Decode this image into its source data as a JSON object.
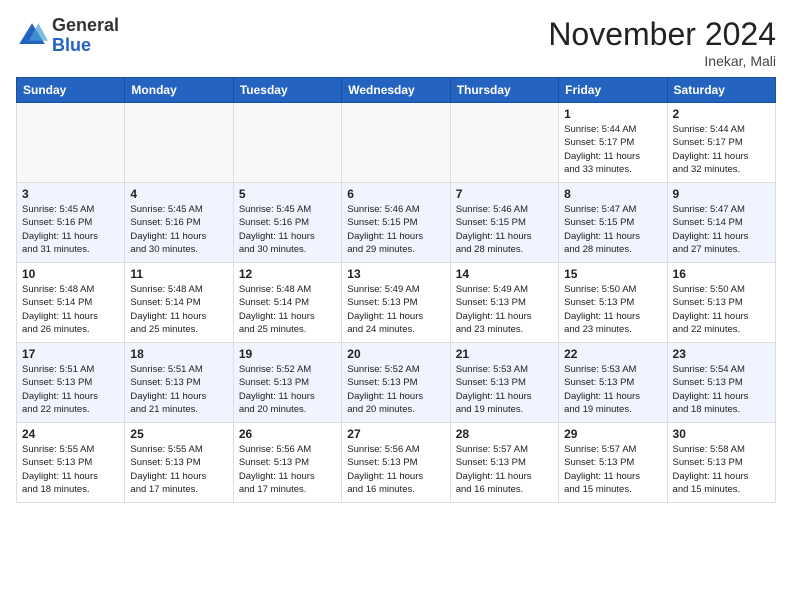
{
  "logo": {
    "general": "General",
    "blue": "Blue"
  },
  "title": "November 2024",
  "location": "Inekar, Mali",
  "weekdays": [
    "Sunday",
    "Monday",
    "Tuesday",
    "Wednesday",
    "Thursday",
    "Friday",
    "Saturday"
  ],
  "weeks": [
    [
      {
        "day": "",
        "info": ""
      },
      {
        "day": "",
        "info": ""
      },
      {
        "day": "",
        "info": ""
      },
      {
        "day": "",
        "info": ""
      },
      {
        "day": "",
        "info": ""
      },
      {
        "day": "1",
        "info": "Sunrise: 5:44 AM\nSunset: 5:17 PM\nDaylight: 11 hours\nand 33 minutes."
      },
      {
        "day": "2",
        "info": "Sunrise: 5:44 AM\nSunset: 5:17 PM\nDaylight: 11 hours\nand 32 minutes."
      }
    ],
    [
      {
        "day": "3",
        "info": "Sunrise: 5:45 AM\nSunset: 5:16 PM\nDaylight: 11 hours\nand 31 minutes."
      },
      {
        "day": "4",
        "info": "Sunrise: 5:45 AM\nSunset: 5:16 PM\nDaylight: 11 hours\nand 30 minutes."
      },
      {
        "day": "5",
        "info": "Sunrise: 5:45 AM\nSunset: 5:16 PM\nDaylight: 11 hours\nand 30 minutes."
      },
      {
        "day": "6",
        "info": "Sunrise: 5:46 AM\nSunset: 5:15 PM\nDaylight: 11 hours\nand 29 minutes."
      },
      {
        "day": "7",
        "info": "Sunrise: 5:46 AM\nSunset: 5:15 PM\nDaylight: 11 hours\nand 28 minutes."
      },
      {
        "day": "8",
        "info": "Sunrise: 5:47 AM\nSunset: 5:15 PM\nDaylight: 11 hours\nand 28 minutes."
      },
      {
        "day": "9",
        "info": "Sunrise: 5:47 AM\nSunset: 5:14 PM\nDaylight: 11 hours\nand 27 minutes."
      }
    ],
    [
      {
        "day": "10",
        "info": "Sunrise: 5:48 AM\nSunset: 5:14 PM\nDaylight: 11 hours\nand 26 minutes."
      },
      {
        "day": "11",
        "info": "Sunrise: 5:48 AM\nSunset: 5:14 PM\nDaylight: 11 hours\nand 25 minutes."
      },
      {
        "day": "12",
        "info": "Sunrise: 5:48 AM\nSunset: 5:14 PM\nDaylight: 11 hours\nand 25 minutes."
      },
      {
        "day": "13",
        "info": "Sunrise: 5:49 AM\nSunset: 5:13 PM\nDaylight: 11 hours\nand 24 minutes."
      },
      {
        "day": "14",
        "info": "Sunrise: 5:49 AM\nSunset: 5:13 PM\nDaylight: 11 hours\nand 23 minutes."
      },
      {
        "day": "15",
        "info": "Sunrise: 5:50 AM\nSunset: 5:13 PM\nDaylight: 11 hours\nand 23 minutes."
      },
      {
        "day": "16",
        "info": "Sunrise: 5:50 AM\nSunset: 5:13 PM\nDaylight: 11 hours\nand 22 minutes."
      }
    ],
    [
      {
        "day": "17",
        "info": "Sunrise: 5:51 AM\nSunset: 5:13 PM\nDaylight: 11 hours\nand 22 minutes."
      },
      {
        "day": "18",
        "info": "Sunrise: 5:51 AM\nSunset: 5:13 PM\nDaylight: 11 hours\nand 21 minutes."
      },
      {
        "day": "19",
        "info": "Sunrise: 5:52 AM\nSunset: 5:13 PM\nDaylight: 11 hours\nand 20 minutes."
      },
      {
        "day": "20",
        "info": "Sunrise: 5:52 AM\nSunset: 5:13 PM\nDaylight: 11 hours\nand 20 minutes."
      },
      {
        "day": "21",
        "info": "Sunrise: 5:53 AM\nSunset: 5:13 PM\nDaylight: 11 hours\nand 19 minutes."
      },
      {
        "day": "22",
        "info": "Sunrise: 5:53 AM\nSunset: 5:13 PM\nDaylight: 11 hours\nand 19 minutes."
      },
      {
        "day": "23",
        "info": "Sunrise: 5:54 AM\nSunset: 5:13 PM\nDaylight: 11 hours\nand 18 minutes."
      }
    ],
    [
      {
        "day": "24",
        "info": "Sunrise: 5:55 AM\nSunset: 5:13 PM\nDaylight: 11 hours\nand 18 minutes."
      },
      {
        "day": "25",
        "info": "Sunrise: 5:55 AM\nSunset: 5:13 PM\nDaylight: 11 hours\nand 17 minutes."
      },
      {
        "day": "26",
        "info": "Sunrise: 5:56 AM\nSunset: 5:13 PM\nDaylight: 11 hours\nand 17 minutes."
      },
      {
        "day": "27",
        "info": "Sunrise: 5:56 AM\nSunset: 5:13 PM\nDaylight: 11 hours\nand 16 minutes."
      },
      {
        "day": "28",
        "info": "Sunrise: 5:57 AM\nSunset: 5:13 PM\nDaylight: 11 hours\nand 16 minutes."
      },
      {
        "day": "29",
        "info": "Sunrise: 5:57 AM\nSunset: 5:13 PM\nDaylight: 11 hours\nand 15 minutes."
      },
      {
        "day": "30",
        "info": "Sunrise: 5:58 AM\nSunset: 5:13 PM\nDaylight: 11 hours\nand 15 minutes."
      }
    ]
  ]
}
